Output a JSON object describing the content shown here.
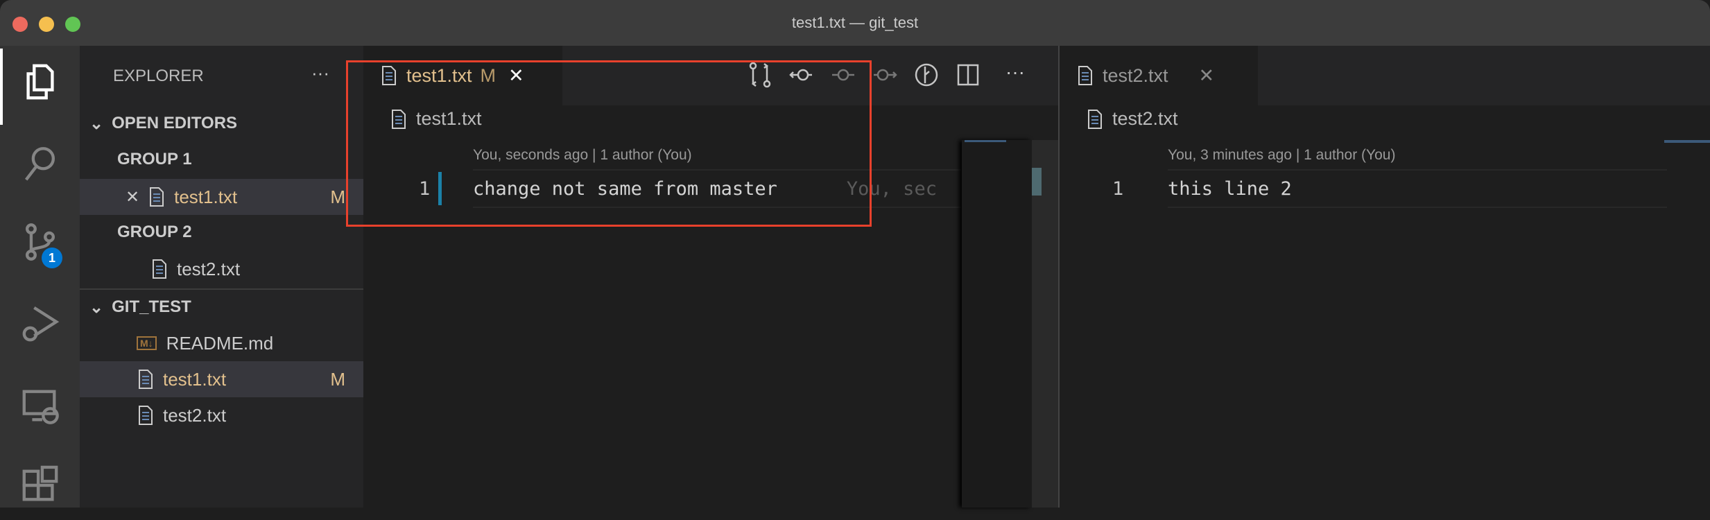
{
  "window": {
    "title": "test1.txt — git_test"
  },
  "activity_bar": {
    "scm_badge": "1",
    "items": [
      "explorer",
      "search",
      "source-control",
      "run-and-debug",
      "remote-explorer",
      "extensions"
    ]
  },
  "sidebar": {
    "header": "EXPLORER",
    "more": "···",
    "open_editors": {
      "label": "OPEN EDITORS",
      "groups": [
        {
          "label": "GROUP 1",
          "files": [
            {
              "name": "test1.txt",
              "status": "M",
              "close": "✕"
            }
          ]
        },
        {
          "label": "GROUP 2",
          "files": [
            {
              "name": "test2.txt"
            }
          ]
        }
      ]
    },
    "folder": {
      "label": "GIT_TEST",
      "files": [
        {
          "name": "README.md",
          "icon_text": "M↓"
        },
        {
          "name": "test1.txt",
          "status": "M"
        },
        {
          "name": "test2.txt"
        }
      ]
    }
  },
  "editor_group_1": {
    "tab": {
      "name": "test1.txt",
      "status": "M",
      "close": "✕"
    },
    "more": "···",
    "breadcrumb": "test1.txt",
    "codelens": "You, seconds ago | 1 author (You)",
    "lines": [
      {
        "number": "1",
        "text": "change not same from master",
        "blame": "You, sec"
      }
    ]
  },
  "editor_group_2": {
    "tab": {
      "name": "test2.txt",
      "close": "✕"
    },
    "breadcrumb": "test2.txt",
    "codelens": "You, 3 minutes ago | 1 author (You)",
    "lines": [
      {
        "number": "1",
        "text": "this line 2"
      }
    ]
  },
  "colors": {
    "modified": "#e2c08d",
    "highlight_box": "#e8412c",
    "badge": "#0078d4"
  }
}
